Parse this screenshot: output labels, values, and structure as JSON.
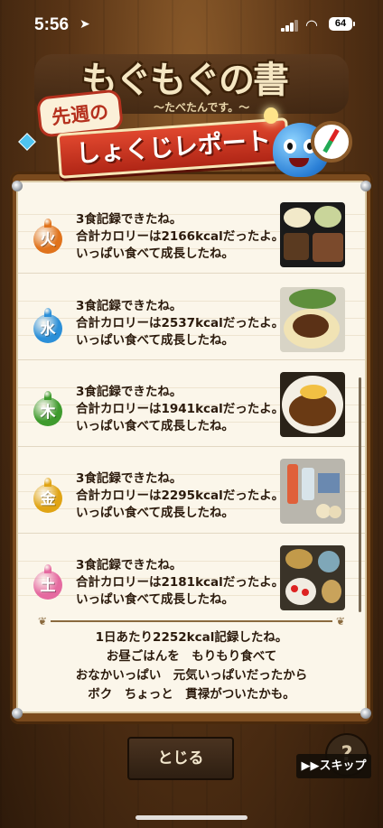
{
  "status_bar": {
    "time": "5:56",
    "battery": "64"
  },
  "header": {
    "logo_title": "もぐもぐの書",
    "logo_subtitle": "〜たべたんです。〜",
    "banner_sub": "先週の",
    "banner_main": "しょくじレポート"
  },
  "entries": [
    {
      "day": "火",
      "color": "#e0731c",
      "line1": "3食記録できたね。",
      "line2": "合計カロリーは2166kcalだったよ。",
      "line3": "いっぱい食べて成長したね。"
    },
    {
      "day": "水",
      "color": "#2b8fd8",
      "line1": "3食記録できたね。",
      "line2": "合計カロリーは2537kcalだったよ。",
      "line3": "いっぱい食べて成長したね。"
    },
    {
      "day": "木",
      "color": "#3f9b2e",
      "line1": "3食記録できたね。",
      "line2": "合計カロリーは1941kcalだったよ。",
      "line3": "いっぱい食べて成長したね。"
    },
    {
      "day": "金",
      "color": "#e0a414",
      "line1": "3食記録できたね。",
      "line2": "合計カロリーは2295kcalだったよ。",
      "line3": "いっぱい食べて成長したね。"
    },
    {
      "day": "土",
      "color": "#e56aa0",
      "line1": "3食記録できたね。",
      "line2": "合計カロリーは2181kcalだったよ。",
      "line3": "いっぱい食べて成長したね。"
    }
  ],
  "summary": {
    "line1": "1日あたり2252kcal記録したね。",
    "line2": "お昼ごはんを　もりもり食べて",
    "line3": "おなかいっぱい　元気いっぱいだったから",
    "line4": "ボク　ちょっと　貫禄がついたかも。"
  },
  "buttons": {
    "close": "とじる",
    "help": "?",
    "skip": "▶▶スキップ"
  }
}
